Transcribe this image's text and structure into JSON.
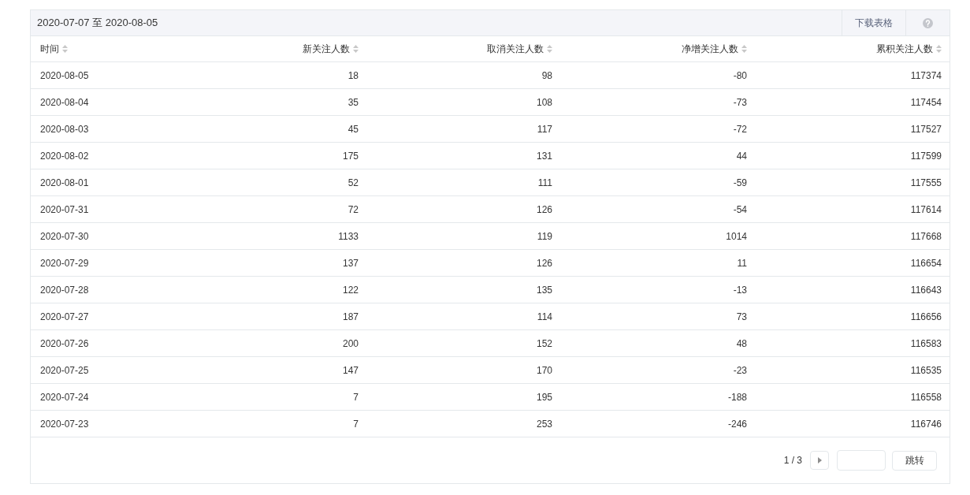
{
  "header": {
    "date_range": "2020-07-07 至 2020-08-05",
    "download_button": "下载表格"
  },
  "table": {
    "columns": [
      "时间",
      "新关注人数",
      "取消关注人数",
      "净增关注人数",
      "累积关注人数"
    ],
    "rows": [
      [
        "2020-08-05",
        "18",
        "98",
        "-80",
        "117374"
      ],
      [
        "2020-08-04",
        "35",
        "108",
        "-73",
        "117454"
      ],
      [
        "2020-08-03",
        "45",
        "117",
        "-72",
        "117527"
      ],
      [
        "2020-08-02",
        "175",
        "131",
        "44",
        "117599"
      ],
      [
        "2020-08-01",
        "52",
        "111",
        "-59",
        "117555"
      ],
      [
        "2020-07-31",
        "72",
        "126",
        "-54",
        "117614"
      ],
      [
        "2020-07-30",
        "1133",
        "119",
        "1014",
        "117668"
      ],
      [
        "2020-07-29",
        "137",
        "126",
        "11",
        "116654"
      ],
      [
        "2020-07-28",
        "122",
        "135",
        "-13",
        "116643"
      ],
      [
        "2020-07-27",
        "187",
        "114",
        "73",
        "116656"
      ],
      [
        "2020-07-26",
        "200",
        "152",
        "48",
        "116583"
      ],
      [
        "2020-07-25",
        "147",
        "170",
        "-23",
        "116535"
      ],
      [
        "2020-07-24",
        "7",
        "195",
        "-188",
        "116558"
      ],
      [
        "2020-07-23",
        "7",
        "253",
        "-246",
        "116746"
      ]
    ]
  },
  "pagination": {
    "page": "1 / 3",
    "jump_button": "跳转"
  }
}
